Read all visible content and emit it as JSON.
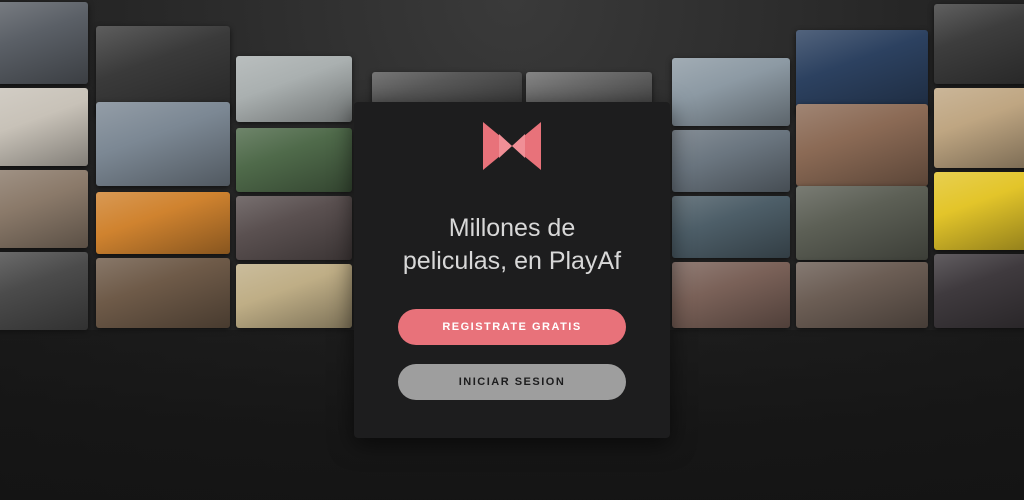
{
  "brand": {
    "name": "PlayAf",
    "accent": "#e8727a",
    "logo_icon": "bowtie-logo-icon"
  },
  "card": {
    "headline_line1": "Millones de",
    "headline_line2": "peliculas, en PlayAf"
  },
  "buttons": {
    "register_label": "REGISTRATE GRATIS",
    "login_label": "INICIAR SESION"
  },
  "colors": {
    "card_bg": "#1d1d1e",
    "register_bg": "#e8727a",
    "login_bg": "#9e9e9e"
  }
}
